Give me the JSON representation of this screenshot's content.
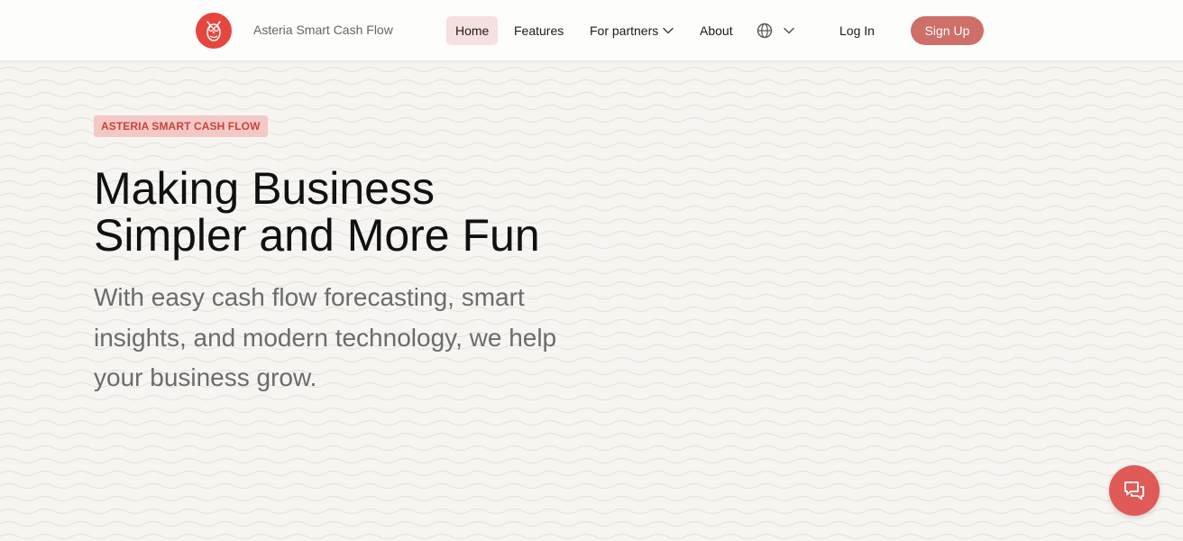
{
  "colors": {
    "logo_bg": "#e5473f",
    "home_active_bg": "#f5e1df",
    "signup_bg": "#cf6f69",
    "badge_bg": "#f3c9c6",
    "badge_text": "#c9423d",
    "chat_bg": "#e05a57"
  },
  "header": {
    "logo_icon": "owl-icon",
    "brand": "Asteria Smart Cash Flow",
    "nav": {
      "home": "Home",
      "features": "Features",
      "partners": "For partners",
      "about": "About"
    },
    "language_icon": "globe-icon",
    "login": "Log In",
    "signup": "Sign Up"
  },
  "hero": {
    "badge": "ASTERIA SMART CASH FLOW",
    "title_line1": "Making Business",
    "title_line2": "Simpler and More Fun",
    "subtitle": "With easy cash flow forecasting, smart insights, and modern technology, we help your business grow."
  },
  "chat_widget": {
    "icon": "chat-bubbles-icon"
  }
}
